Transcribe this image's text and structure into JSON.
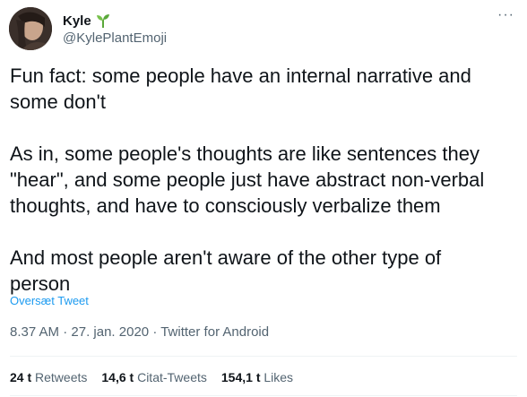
{
  "user": {
    "display_name": "Kyle",
    "badge_icon": "seedling-icon",
    "handle": "@KylePlantEmoji"
  },
  "tweet": {
    "text": "Fun fact: some people have an internal narrative and\nsome don't\n\nAs in, some people's thoughts are like sentences they\n\"hear\", and some people just have abstract non-verbal\nthoughts, and have to consciously verbalize them\n\nAnd most people aren't aware of the other type of\nperson",
    "translate_label": "Oversæt Tweet",
    "time": "8.37 AM",
    "date": "27. jan. 2020",
    "source": "Twitter for Android",
    "separator": "·"
  },
  "stats": {
    "retweets_count": "24 t",
    "retweets_label": "Retweets",
    "quotes_count": "14,6 t",
    "quotes_label": "Citat-Tweets",
    "likes_count": "154,1 t",
    "likes_label": "Likes"
  },
  "colors": {
    "link": "#1d9bf0",
    "secondary": "#536471",
    "primary": "#0f1419",
    "plant": "#5aa83a"
  }
}
